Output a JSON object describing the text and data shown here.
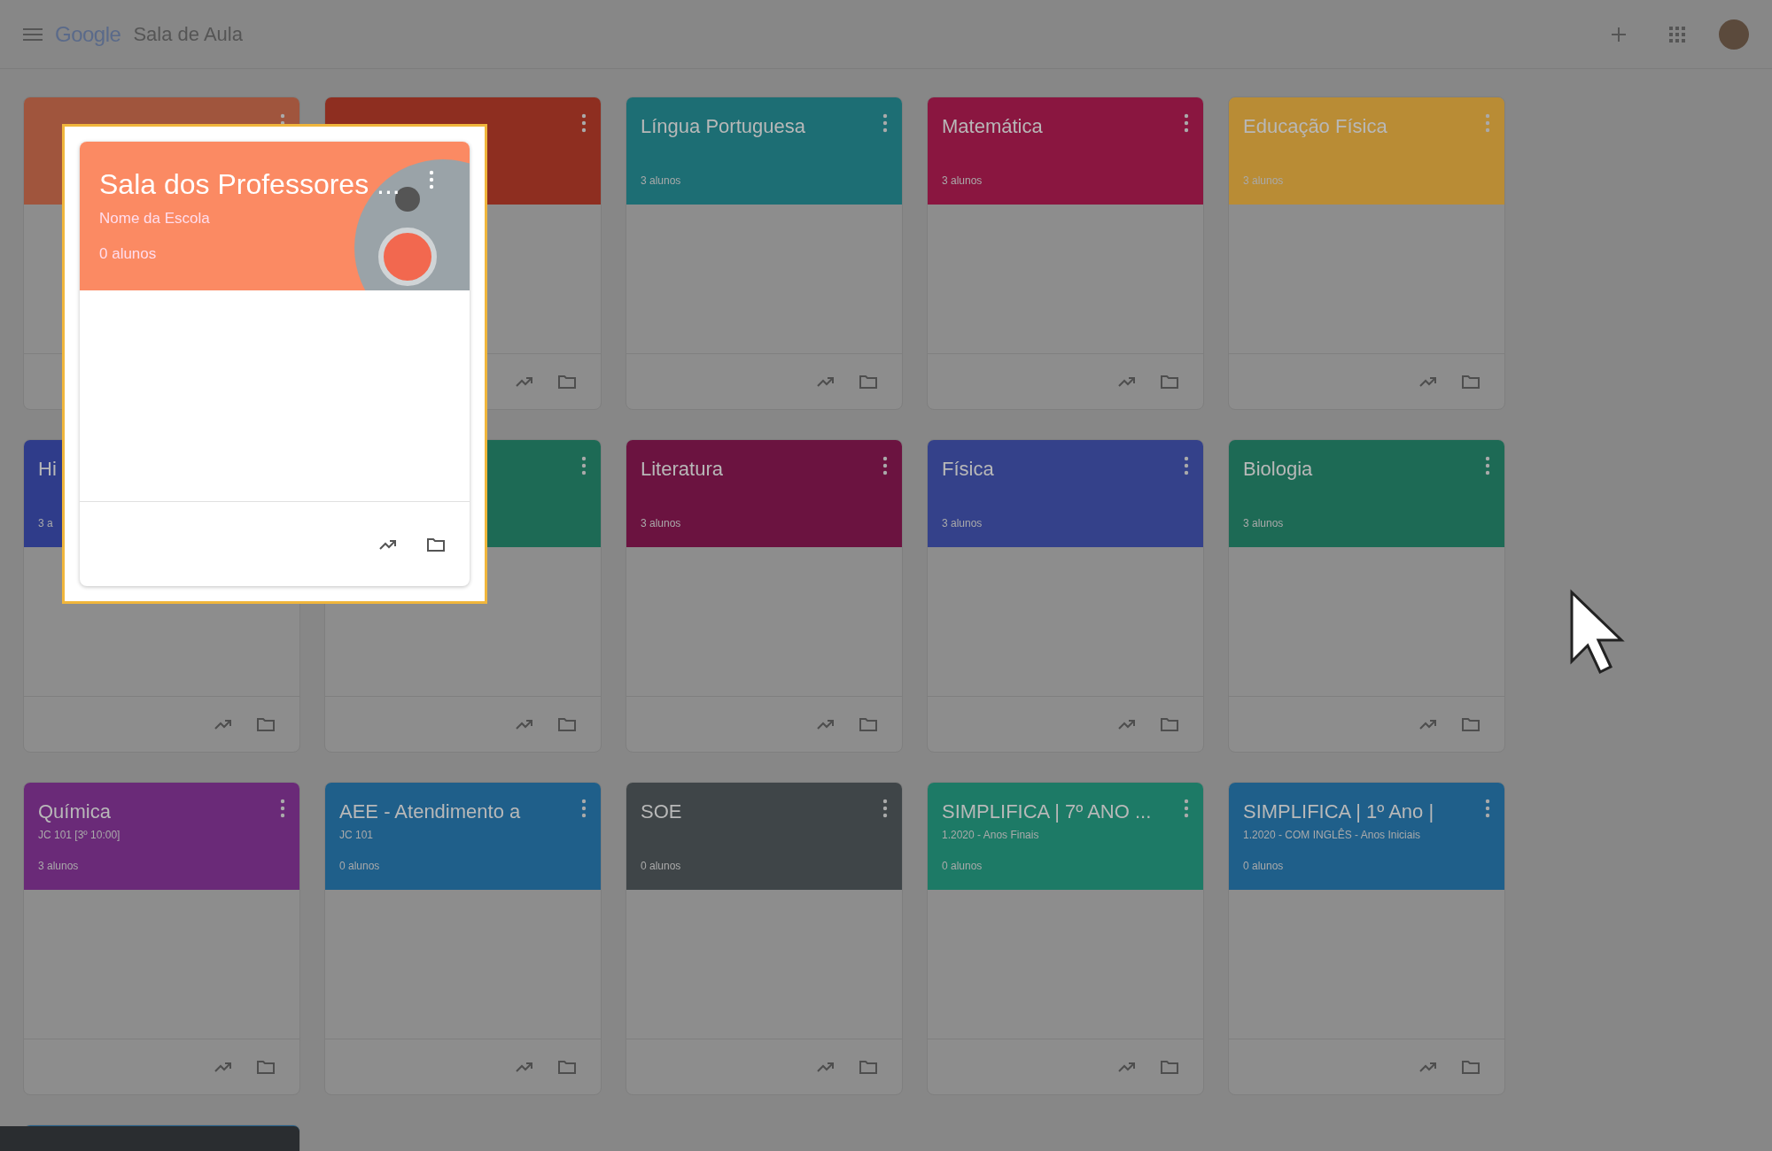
{
  "app_bar": {
    "logo": "Google",
    "title": "Sala de Aula"
  },
  "classes": [
    {
      "color": "#a0553d"
    },
    {
      "color": "#8e2e20"
    },
    {
      "title": "Língua Portuguesa",
      "students": "3 alunos",
      "color": "#1d6e74"
    },
    {
      "title": "Matemática",
      "students": "3 alunos",
      "color": "#8a1640"
    },
    {
      "title": "Educação Física",
      "students": "3 alunos",
      "color": "#b98c35"
    },
    {
      "title": "Hi",
      "students": "3 a",
      "color": "#2f3c8a"
    },
    {
      "color": "#1d6a55"
    },
    {
      "title": "Literatura",
      "students": "3 alunos",
      "color": "#6b1340"
    },
    {
      "title": "Física",
      "students": "3 alunos",
      "color": "#34418a"
    },
    {
      "title": "Biologia",
      "students": "3 alunos",
      "color": "#1d6a55"
    },
    {
      "title": "Química",
      "section": "JC 101 [3º 10:00]",
      "students": "3 alunos",
      "color": "#6a2a78"
    },
    {
      "title": "AEE - Atendimento a",
      "section": "JC 101",
      "students": "0 alunos",
      "color": "#1f5f8a"
    },
    {
      "title": "SOE",
      "students": "0 alunos",
      "color": "#3f4548"
    },
    {
      "title": "SIMPLIFICA | 7º ANO ...",
      "section": "1.2020 - Anos Finais",
      "students": "0 alunos",
      "color": "#1d7a66"
    },
    {
      "title": "SIMPLIFICA | 1º Ano |",
      "section": "1.2020 - COM INGLÊS - Anos Iniciais",
      "students": "0 alunos",
      "color": "#1f5f8a"
    },
    {
      "color": "#1f5f8a"
    }
  ],
  "highlight": {
    "title": "Sala dos Professores ...",
    "section": "Nome da Escola",
    "students": "0 alunos",
    "color": "#fb8a63"
  }
}
